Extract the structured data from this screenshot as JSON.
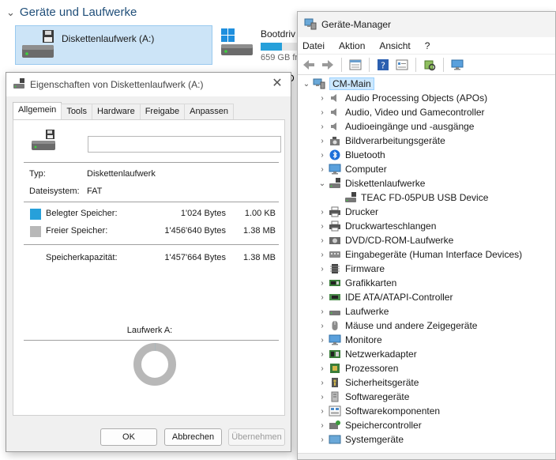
{
  "explorer": {
    "section_title": "Geräte und Laufwerke",
    "drive_label": "Diskettenlaufwerk (A:)",
    "boot_name": "Bootdriv",
    "boot_free": "659 GB fr",
    "boot_usage_fraction": 0.45,
    "peek_text": "D"
  },
  "properties": {
    "title": "Eigenschaften von Diskettenlaufwerk (A:)",
    "tabs": [
      "Allgemein",
      "Tools",
      "Hardware",
      "Freigabe",
      "Anpassen"
    ],
    "name_value": "",
    "type_label": "Typ:",
    "type_value": "Diskettenlaufwerk",
    "fs_label": "Dateisystem:",
    "fs_value": "FAT",
    "used_label": "Belegter Speicher:",
    "used_bytes": "1'024 Bytes",
    "used_size": "1.00 KB",
    "free_label": "Freier Speicher:",
    "free_bytes": "1'456'640 Bytes",
    "free_size": "1.38 MB",
    "cap_label": "Speicherkapazität:",
    "cap_bytes": "1'457'664 Bytes",
    "cap_size": "1.38 MB",
    "drive_caption": "Laufwerk A:",
    "used_fraction": 0.0007,
    "buttons": {
      "ok": "OK",
      "cancel": "Abbrechen",
      "apply": "Übernehmen"
    },
    "colors": {
      "used": "#26a0da",
      "free": "#b8b8b8"
    }
  },
  "device_manager": {
    "title": "Geräte-Manager",
    "menu": [
      "Datei",
      "Aktion",
      "Ansicht",
      "?"
    ],
    "root": "CM-Main",
    "expanded_child": "TEAC FD-05PUB USB Device",
    "categories": [
      {
        "label": "Audio Processing Objects (APOs)",
        "icon": "speaker-icon"
      },
      {
        "label": "Audio, Video und Gamecontroller",
        "icon": "speaker-icon"
      },
      {
        "label": "Audioeingänge und -ausgänge",
        "icon": "speaker-icon"
      },
      {
        "label": "Bildverarbeitungsgeräte",
        "icon": "camera-icon"
      },
      {
        "label": "Bluetooth",
        "icon": "bluetooth-icon"
      },
      {
        "label": "Computer",
        "icon": "monitor-icon"
      },
      {
        "label": "Diskettenlaufwerke",
        "icon": "floppy-drive-icon",
        "expanded": true
      },
      {
        "label": "Drucker",
        "icon": "printer-icon"
      },
      {
        "label": "Druckwarteschlangen",
        "icon": "printer-icon"
      },
      {
        "label": "DVD/CD-ROM-Laufwerke",
        "icon": "disc-icon"
      },
      {
        "label": "Eingabegeräte (Human Interface Devices)",
        "icon": "hid-icon"
      },
      {
        "label": "Firmware",
        "icon": "chip-icon"
      },
      {
        "label": "Grafikkarten",
        "icon": "gpu-icon"
      },
      {
        "label": "IDE ATA/ATAPI-Controller",
        "icon": "controller-icon"
      },
      {
        "label": "Laufwerke",
        "icon": "drive-icon"
      },
      {
        "label": "Mäuse und andere Zeigegeräte",
        "icon": "mouse-icon"
      },
      {
        "label": "Monitore",
        "icon": "monitor-icon"
      },
      {
        "label": "Netzwerkadapter",
        "icon": "network-icon"
      },
      {
        "label": "Prozessoren",
        "icon": "cpu-icon"
      },
      {
        "label": "Sicherheitsgeräte",
        "icon": "security-icon"
      },
      {
        "label": "Softwaregeräte",
        "icon": "software-icon"
      },
      {
        "label": "Softwarekomponenten",
        "icon": "component-icon"
      },
      {
        "label": "Speichercontroller",
        "icon": "storage-controller-icon"
      },
      {
        "label": "Systemgeräte",
        "icon": "system-icon"
      }
    ]
  }
}
